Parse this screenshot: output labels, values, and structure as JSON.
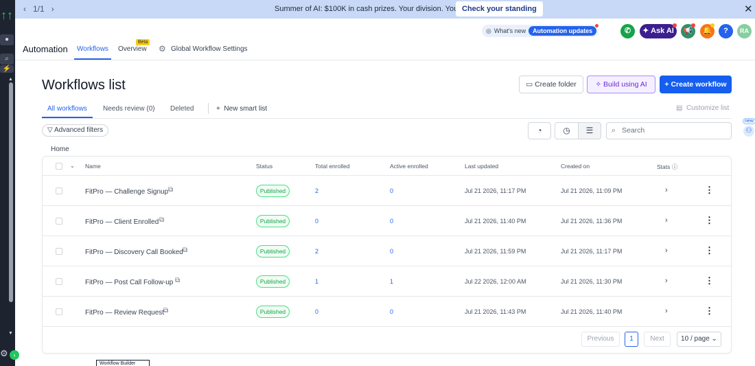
{
  "banner": {
    "counter": "1/1",
    "message": "Summer of AI: $100K in cash prizes. Your division. Your clients.",
    "cta": "Check your standing"
  },
  "header": {
    "whats_new": "What's new",
    "automation_updates": "Automation updates",
    "ask_ai": "Ask AI",
    "avatar_initials": "RA",
    "app_title": "Automation",
    "tabs": [
      "Workflows",
      "Overview",
      "Global Workflow Settings"
    ],
    "beta": "Beta"
  },
  "main": {
    "title": "Workflows list",
    "buttons": {
      "create_folder": "Create folder",
      "build_ai": "Build using AI",
      "create_workflow": "Create workflow"
    },
    "subtabs": [
      "All workflows",
      "Needs review (0)",
      "Deleted"
    ],
    "new_smart_list": "New smart list",
    "customize_list": "Customize list",
    "advanced_filters": "Advanced filters",
    "search_placeholder": "Search",
    "new_tag": "new",
    "breadcrumb": "Home"
  },
  "table": {
    "columns": [
      "Name",
      "Status",
      "Total enrolled",
      "Active enrolled",
      "Last updated",
      "Created on",
      "Stats"
    ],
    "rows": [
      {
        "name": "FitPro — Challenge Signup",
        "status": "Published",
        "total": "2",
        "active": "0",
        "updated": "Jul 21 2026, 11:17 PM",
        "created": "Jul 21 2026, 11:09 PM"
      },
      {
        "name": "FitPro — Client Enrolled",
        "status": "Published",
        "total": "0",
        "active": "0",
        "updated": "Jul 21 2026, 11:40 PM",
        "created": "Jul 21 2026, 11:36 PM"
      },
      {
        "name": "FitPro — Discovery Call Booked",
        "status": "Published",
        "total": "2",
        "active": "0",
        "updated": "Jul 21 2026, 11:59 PM",
        "created": "Jul 21 2026, 11:17 PM"
      },
      {
        "name": "FitPro — Post Call Follow-up",
        "status": "Published",
        "total": "1",
        "active": "1",
        "updated": "Jul 22 2026, 12:00 AM",
        "created": "Jul 21 2026, 11:30 PM"
      },
      {
        "name": "FitPro — Review Request",
        "status": "Published",
        "total": "0",
        "active": "0",
        "updated": "Jul 21 2026, 11:43 PM",
        "created": "Jul 21 2026, 11:40 PM"
      }
    ]
  },
  "pagination": {
    "previous": "Previous",
    "current": "1",
    "next": "Next",
    "page_size": "10 / page"
  },
  "tooltip": "Workflow Builder",
  "colors": {
    "primary": "#155eef",
    "banner_bg": "#c7d9f7",
    "published": "#16a34a",
    "rail": "#1e2330"
  }
}
